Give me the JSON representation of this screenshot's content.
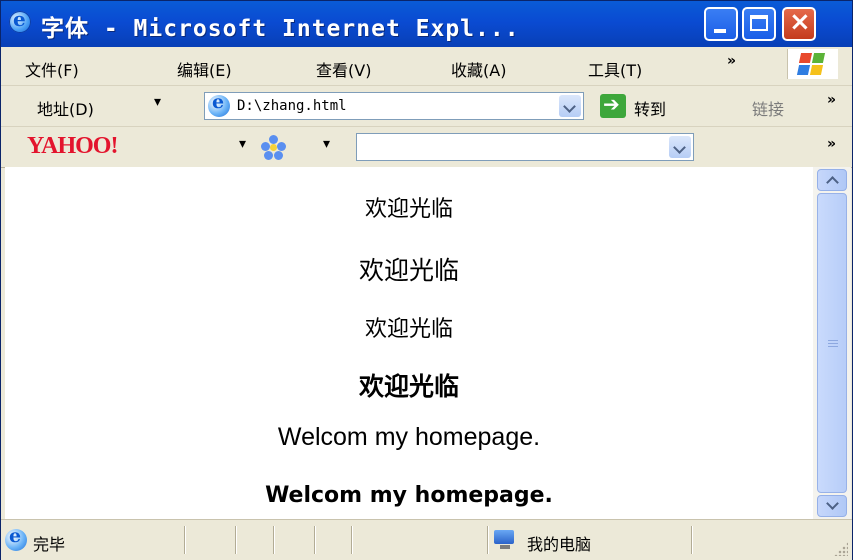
{
  "window": {
    "title": "字体 - Microsoft Internet Expl..."
  },
  "menubar": {
    "items": [
      "文件(F)",
      "编辑(E)",
      "查看(V)",
      "收藏(A)",
      "工具(T)"
    ],
    "overflow": "»"
  },
  "addressbar": {
    "label": "地址(D)",
    "value": "D:\\zhang.html",
    "go_label": "转到",
    "links_label": "链接",
    "overflow": "»"
  },
  "yahoo_toolbar": {
    "logo": "YAHOO!",
    "search_value": "",
    "overflow": "»"
  },
  "content": {
    "lines": [
      "欢迎光临",
      "欢迎光临",
      "欢迎光临",
      "欢迎光临",
      "Welcom my homepage.",
      "Welcom my homepage."
    ]
  },
  "statusbar": {
    "status": "完毕",
    "zone": "我的电脑"
  },
  "colors": {
    "titlebar": "#0a4bd2",
    "close_button": "#c43b1d",
    "yahoo_red": "#e3142d",
    "go_green": "#3ea73b",
    "chrome": "#ece9d8"
  },
  "icons": [
    "ie-icon",
    "minimize-icon",
    "maximize-icon",
    "close-icon",
    "windows-logo-icon",
    "go-arrow-icon",
    "chevron-down-icon",
    "flower-icon",
    "monitor-icon",
    "resize-grip-icon"
  ]
}
